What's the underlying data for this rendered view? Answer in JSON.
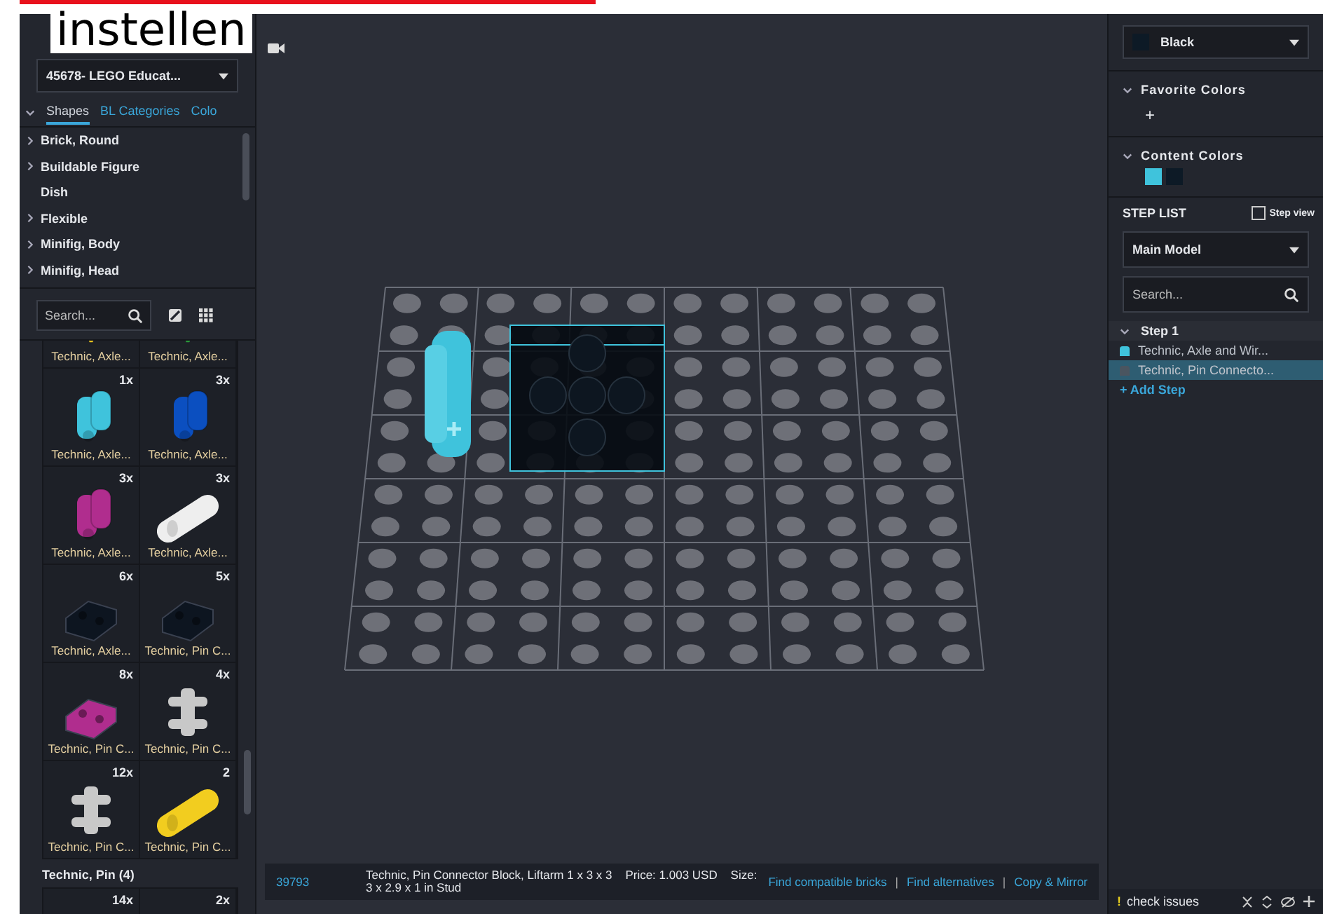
{
  "annotation": {
    "text": "instellen"
  },
  "left_panel": {
    "set_dropdown": "45678- LEGO Educat...",
    "tabs": [
      {
        "label": "Shapes",
        "selected": true
      },
      {
        "label": "BL Categories",
        "selected": false
      },
      {
        "label": "Colo",
        "selected": false
      }
    ],
    "categories": [
      {
        "label": "Brick, Round",
        "expandable": true
      },
      {
        "label": "Buildable Figure",
        "expandable": true
      },
      {
        "label": "Dish",
        "expandable": false
      },
      {
        "label": "Flexible",
        "expandable": true
      },
      {
        "label": "Minifig, Body",
        "expandable": true
      },
      {
        "label": "Minifig, Head",
        "expandable": true
      }
    ],
    "search": {
      "placeholder": "Search..."
    },
    "parts": [
      {
        "label": "Technic, Axle...",
        "color": "#e8c31e",
        "kind": "cap"
      },
      {
        "label": "Technic, Axle...",
        "color": "#2a9a3a",
        "kind": "cap"
      },
      {
        "count": "1x",
        "label": "Technic, Axle...",
        "color": "#3fc3dc",
        "kind": "connector"
      },
      {
        "count": "3x",
        "label": "Technic, Axle...",
        "color": "#0b4fc0",
        "kind": "connector"
      },
      {
        "count": "3x",
        "label": "Technic, Axle...",
        "color": "#b02d8e",
        "kind": "connector"
      },
      {
        "count": "3x",
        "label": "Technic, Axle...",
        "color": "#eeeeee",
        "kind": "tube"
      },
      {
        "count": "6x",
        "label": "Technic, Axle...",
        "color": "#0d1520",
        "kind": "block"
      },
      {
        "count": "5x",
        "label": "Technic, Pin C...",
        "color": "#0d1520",
        "kind": "block"
      },
      {
        "count": "8x",
        "label": "Technic, Pin C...",
        "color": "#b02d8e",
        "kind": "block"
      },
      {
        "count": "4x",
        "label": "Technic, Pin C...",
        "color": "#c8c8c8",
        "kind": "cross"
      },
      {
        "count": "12x",
        "label": "Technic, Pin C...",
        "color": "#c8c8c8",
        "kind": "cross"
      },
      {
        "count": "2",
        "label": "Technic, Pin C...",
        "color": "#f2cd1f",
        "kind": "tube"
      }
    ],
    "group_heading": "Technic, Pin (4)",
    "next_parts": [
      {
        "count": "14x"
      },
      {
        "count": "2x"
      }
    ]
  },
  "canvas": {
    "info": {
      "part_number": "39793",
      "description": "Technic, Pin Connector Block, Liftarm 1 x 3 x 3    Price: 1.003 USD    Size:",
      "size": "3 x 2.9 x 1 in Stud",
      "links": [
        "Find compatible bricks",
        "Find alternatives",
        "Copy & Mirror"
      ],
      "separators": [
        "|",
        "|"
      ]
    }
  },
  "right_panel": {
    "color_dropdown": {
      "label": "Black",
      "color": "#0d1a26"
    },
    "favorite_colors": {
      "title": "Favorite Colors",
      "add": "+"
    },
    "content_colors": {
      "title": "Content Colors",
      "swatches": [
        {
          "color": "#3fc3dc"
        },
        {
          "color": "#0d1a26"
        }
      ]
    },
    "step_list": {
      "title": "STEP LIST",
      "step_view": {
        "label": "Step view",
        "checked": false
      },
      "model_dropdown": "Main Model",
      "search": {
        "placeholder": "Search..."
      },
      "steps": [
        {
          "label": "Step 1",
          "expanded": true,
          "items": [
            {
              "label": "Technic, Axle and Wir...",
              "color": "#3fc3dc",
              "selected": false
            },
            {
              "label": "Technic, Pin Connecto...",
              "color": "#4a5560",
              "selected": true
            }
          ]
        }
      ],
      "add_step": "+ Add Step"
    },
    "status": {
      "warning": "!",
      "label": "check issues"
    }
  }
}
